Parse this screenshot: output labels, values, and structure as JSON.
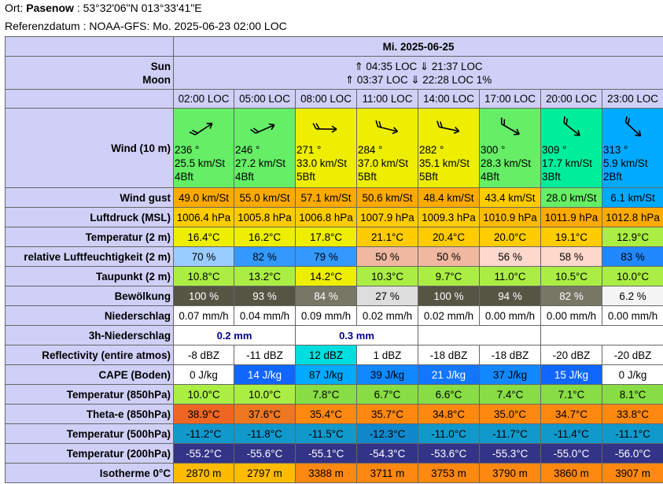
{
  "header": {
    "ort_label": "Ort: ",
    "ort_name": "Pasenow",
    "ort_coords": " : 53°32'06\"N 013°33'41\"E",
    "referenz": "Referenzdatum : NOAA-GFS: Mo. 2025-06-23 02:00 LOC"
  },
  "date": "Mi. 2025-06-25",
  "sun_moon": {
    "sun_label": "Sun",
    "moon_label": "Moon",
    "sun": "⇑ 04:35 LOC ⇓ 21:37 LOC",
    "moon": "⇑ 03:37 LOC ⇓ 22:28 LOC  1%"
  },
  "times": [
    "02:00 LOC",
    "05:00 LOC",
    "08:00 LOC",
    "11:00 LOC",
    "14:00 LOC",
    "17:00 LOC",
    "20:00 LOC",
    "23:00 LOC"
  ],
  "wind": {
    "label": "Wind (10 m)",
    "cells": [
      {
        "dir": "236 °",
        "speed": "25.5  km/St",
        "bft": "4Bft",
        "deg": 236,
        "color": "#66ee66"
      },
      {
        "dir": "246 °",
        "speed": "27.2  km/St",
        "bft": "4Bft",
        "deg": 246,
        "color": "#66ee66"
      },
      {
        "dir": "271 °",
        "speed": "33.0  km/St",
        "bft": "5Bft",
        "deg": 271,
        "color": "#eeee00"
      },
      {
        "dir": "284 °",
        "speed": "37.0  km/St",
        "bft": "5Bft",
        "deg": 284,
        "color": "#eeee00"
      },
      {
        "dir": "282 °",
        "speed": "35.1  km/St",
        "bft": "5Bft",
        "deg": 282,
        "color": "#eeee00"
      },
      {
        "dir": "300 °",
        "speed": "28.3  km/St",
        "bft": "4Bft",
        "deg": 300,
        "color": "#66ee66"
      },
      {
        "dir": "309 °",
        "speed": "17.7  km/St",
        "bft": "3Bft",
        "deg": 309,
        "color": "#00ee99"
      },
      {
        "dir": "313 °",
        "speed": "5.9  km/St",
        "bft": "2Bft",
        "deg": 313,
        "color": "#00aaff"
      }
    ]
  },
  "rows": [
    {
      "label": "Wind gust",
      "cells": [
        {
          "v": "49.0  km/St",
          "bg": "#ffaa00"
        },
        {
          "v": "55.0  km/St",
          "bg": "#ffaa00"
        },
        {
          "v": "57.1  km/St",
          "bg": "#ffaa00"
        },
        {
          "v": "50.6  km/St",
          "bg": "#ffaa00"
        },
        {
          "v": "48.4  km/St",
          "bg": "#ffaa00"
        },
        {
          "v": "43.4  km/St",
          "bg": "#ffcc00"
        },
        {
          "v": "28.0  km/St",
          "bg": "#66ee66"
        },
        {
          "v": "6.1  km/St",
          "bg": "#00aaff"
        }
      ]
    },
    {
      "label": "Luftdruck (MSL)",
      "cells": [
        {
          "v": "1006.4 hPa",
          "bg": "#ffcc00"
        },
        {
          "v": "1005.8 hPa",
          "bg": "#ffcc00"
        },
        {
          "v": "1006.8 hPa",
          "bg": "#ffcc00"
        },
        {
          "v": "1007.9 hPa",
          "bg": "#ffcc00"
        },
        {
          "v": "1009.3 hPa",
          "bg": "#ffcc00"
        },
        {
          "v": "1010.9 hPa",
          "bg": "#ffbb00"
        },
        {
          "v": "1011.9 hPa",
          "bg": "#ffaa00"
        },
        {
          "v": "1012.8 hPa",
          "bg": "#ffaa00"
        }
      ]
    },
    {
      "label": "Temperatur (2 m)",
      "cells": [
        {
          "v": "16.4°C",
          "bg": "#eeee00"
        },
        {
          "v": "16.2°C",
          "bg": "#eeee00"
        },
        {
          "v": "17.8°C",
          "bg": "#eeee00"
        },
        {
          "v": "21.1°C",
          "bg": "#ffcc00"
        },
        {
          "v": "20.4°C",
          "bg": "#ffcc00"
        },
        {
          "v": "20.0°C",
          "bg": "#ffcc00"
        },
        {
          "v": "19.1°C",
          "bg": "#ffcc00"
        },
        {
          "v": "12.9°C",
          "bg": "#aaee44"
        }
      ]
    },
    {
      "label": "relative Luftfeuchtigkeit (2 m)",
      "cells": [
        {
          "v": "70 %",
          "bg": "#99ccff"
        },
        {
          "v": "82 %",
          "bg": "#3399ff"
        },
        {
          "v": "79 %",
          "bg": "#3399ff"
        },
        {
          "v": "50 %",
          "bg": "#f0b8a0"
        },
        {
          "v": "50 %",
          "bg": "#f0b8a0"
        },
        {
          "v": "56 %",
          "bg": "#ffd8cc"
        },
        {
          "v": "58 %",
          "bg": "#ffd8cc"
        },
        {
          "v": "83 %",
          "bg": "#2288ff"
        }
      ]
    },
    {
      "label": "Taupunkt (2 m)",
      "cells": [
        {
          "v": "10.8°C",
          "bg": "#aaee44"
        },
        {
          "v": "13.2°C",
          "bg": "#aaee44"
        },
        {
          "v": "14.2°C",
          "bg": "#eeee00"
        },
        {
          "v": "10.3°C",
          "bg": "#aaee44"
        },
        {
          "v": "9.7°C",
          "bg": "#aaee44"
        },
        {
          "v": "11.0°C",
          "bg": "#aaee44"
        },
        {
          "v": "10.5°C",
          "bg": "#aaee44"
        },
        {
          "v": "10.0°C",
          "bg": "#aaee44"
        }
      ]
    },
    {
      "label": "Bewölkung",
      "cells": [
        {
          "v": "100 %",
          "bg": "#555544",
          "fg": "#ffffff"
        },
        {
          "v": "93 %",
          "bg": "#555544",
          "fg": "#ffffff"
        },
        {
          "v": "84 %",
          "bg": "#777766",
          "fg": "#ffffff"
        },
        {
          "v": "27 %",
          "bg": "#dddddd"
        },
        {
          "v": "100 %",
          "bg": "#555544",
          "fg": "#ffffff"
        },
        {
          "v": "94 %",
          "bg": "#555544",
          "fg": "#ffffff"
        },
        {
          "v": "82 %",
          "bg": "#777766",
          "fg": "#ffffff"
        },
        {
          "v": "6.2 %",
          "bg": "#f4f4f4"
        }
      ]
    },
    {
      "label": "Niederschlag",
      "cells": [
        {
          "v": "0.07 mm/h",
          "bg": "#ffffff"
        },
        {
          "v": "0.04 mm/h",
          "bg": "#ffffff"
        },
        {
          "v": "0.09 mm/h",
          "bg": "#ffffff"
        },
        {
          "v": "0.02 mm/h",
          "bg": "#ffffff"
        },
        {
          "v": "0.02 mm/h",
          "bg": "#ffffff"
        },
        {
          "v": "0.00 mm/h",
          "bg": "#ffffff"
        },
        {
          "v": "0.00 mm/h",
          "bg": "#ffffff"
        },
        {
          "v": "0.00 mm/h",
          "bg": "#ffffff"
        }
      ]
    },
    {
      "label": "3h-Niederschlag",
      "precip3": [
        "0.2 mm",
        "0.3 mm"
      ]
    },
    {
      "label": "Reflectivity (entire atmos)",
      "cells": [
        {
          "v": "-8 dBZ",
          "bg": "#ffffff"
        },
        {
          "v": "-11 dBZ",
          "bg": "#ffffff"
        },
        {
          "v": "12 dBZ",
          "bg": "#00dddd"
        },
        {
          "v": "1 dBZ",
          "bg": "#ffffff"
        },
        {
          "v": "-18 dBZ",
          "bg": "#ffffff"
        },
        {
          "v": "-18 dBZ",
          "bg": "#ffffff"
        },
        {
          "v": "-20 dBZ",
          "bg": "#ffffff"
        },
        {
          "v": "-20 dBZ",
          "bg": "#ffffff"
        }
      ]
    },
    {
      "label": "CAPE (Boden)",
      "cells": [
        {
          "v": "0 J/kg",
          "bg": "#ffffff"
        },
        {
          "v": "14 J/kg",
          "bg": "#1166ff",
          "fg": "#ffffff"
        },
        {
          "v": "87 J/kg",
          "bg": "#00aaff"
        },
        {
          "v": "39 J/kg",
          "bg": "#1188ff"
        },
        {
          "v": "21 J/kg",
          "bg": "#1177ff",
          "fg": "#ffffff"
        },
        {
          "v": "37 J/kg",
          "bg": "#1188ff"
        },
        {
          "v": "15 J/kg",
          "bg": "#1166ff",
          "fg": "#ffffff"
        },
        {
          "v": "0 J/kg",
          "bg": "#ffffff"
        }
      ]
    },
    {
      "label": "Temperatur (850hPa)",
      "cells": [
        {
          "v": "10.0°C",
          "bg": "#aaee44"
        },
        {
          "v": "10.0°C",
          "bg": "#aaee44"
        },
        {
          "v": "7.8°C",
          "bg": "#88dd44"
        },
        {
          "v": "6.7°C",
          "bg": "#88dd44"
        },
        {
          "v": "6.6°C",
          "bg": "#88dd44"
        },
        {
          "v": "7.4°C",
          "bg": "#88dd44"
        },
        {
          "v": "7.1°C",
          "bg": "#88dd44"
        },
        {
          "v": "8.1°C",
          "bg": "#88dd44"
        }
      ]
    },
    {
      "label": "Theta-e (850hPa)",
      "cells": [
        {
          "v": "38.9°C",
          "bg": "#ee6622"
        },
        {
          "v": "37.6°C",
          "bg": "#ee7722"
        },
        {
          "v": "35.4°C",
          "bg": "#ff8811"
        },
        {
          "v": "35.7°C",
          "bg": "#ff8811"
        },
        {
          "v": "34.8°C",
          "bg": "#ff8811"
        },
        {
          "v": "35.0°C",
          "bg": "#ff8811"
        },
        {
          "v": "34.7°C",
          "bg": "#ff8811"
        },
        {
          "v": "33.8°C",
          "bg": "#ff8811"
        }
      ]
    },
    {
      "label": "Temperatur (500hPa)",
      "cells": [
        {
          "v": "-11.2°C",
          "bg": "#1199cc"
        },
        {
          "v": "-11.8°C",
          "bg": "#1199cc"
        },
        {
          "v": "-11.5°C",
          "bg": "#1199cc"
        },
        {
          "v": "-12.3°C",
          "bg": "#1188cc"
        },
        {
          "v": "-11.0°C",
          "bg": "#1199cc"
        },
        {
          "v": "-11.7°C",
          "bg": "#1199cc"
        },
        {
          "v": "-11.4°C",
          "bg": "#1199cc"
        },
        {
          "v": "-11.1°C",
          "bg": "#1199cc"
        }
      ]
    },
    {
      "label": "Temperatur (200hPa)",
      "cells": [
        {
          "v": "-55.2°C",
          "bg": "#333388",
          "fg": "#ffffff"
        },
        {
          "v": "-55.6°C",
          "bg": "#333388",
          "fg": "#ffffff"
        },
        {
          "v": "-55.1°C",
          "bg": "#333388",
          "fg": "#ffffff"
        },
        {
          "v": "-54.3°C",
          "bg": "#333388",
          "fg": "#ffffff"
        },
        {
          "v": "-53.6°C",
          "bg": "#333388",
          "fg": "#ffffff"
        },
        {
          "v": "-55.3°C",
          "bg": "#333388",
          "fg": "#ffffff"
        },
        {
          "v": "-55.0°C",
          "bg": "#333388",
          "fg": "#ffffff"
        },
        {
          "v": "-56.0°C",
          "bg": "#333388",
          "fg": "#ffffff"
        }
      ]
    },
    {
      "label": "Isotherme 0°C",
      "cells": [
        {
          "v": "2870 m",
          "bg": "#ffbb00"
        },
        {
          "v": "2797 m",
          "bg": "#ffbb00"
        },
        {
          "v": "3388 m",
          "bg": "#ff8811"
        },
        {
          "v": "3711 m",
          "bg": "#ff8811"
        },
        {
          "v": "3753 m",
          "bg": "#ff8811"
        },
        {
          "v": "3790 m",
          "bg": "#ff8811"
        },
        {
          "v": "3860 m",
          "bg": "#ff8811"
        },
        {
          "v": "3907 m",
          "bg": "#ff8811"
        }
      ]
    }
  ]
}
